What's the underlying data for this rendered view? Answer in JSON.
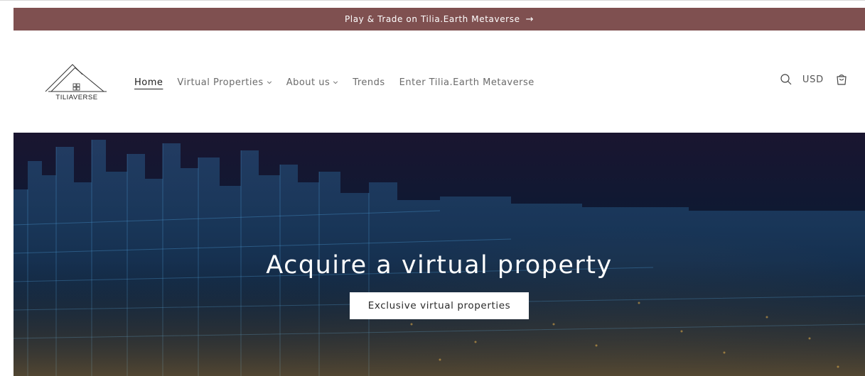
{
  "announcement": {
    "text": "Play & Trade on Tilia.Earth Metaverse",
    "arrow": "→"
  },
  "logo": {
    "text": "TILIAVERSE"
  },
  "nav": {
    "items": [
      {
        "label": "Home",
        "active": true,
        "dropdown": false
      },
      {
        "label": "Virtual Properties",
        "active": false,
        "dropdown": true
      },
      {
        "label": "About us",
        "active": false,
        "dropdown": true
      },
      {
        "label": "Trends",
        "active": false,
        "dropdown": false
      },
      {
        "label": "Enter Tilia.Earth Metaverse",
        "active": false,
        "dropdown": false
      }
    ]
  },
  "tools": {
    "search_icon": "search-icon",
    "currency": "USD",
    "cart_icon": "cart-icon"
  },
  "hero": {
    "title": "Acquire a virtual property",
    "button_label": "Exclusive virtual properties"
  },
  "colors": {
    "announcement_bg": "#7f5050",
    "hero_bg": "#0c1a33",
    "button_bg": "#ffffff"
  }
}
